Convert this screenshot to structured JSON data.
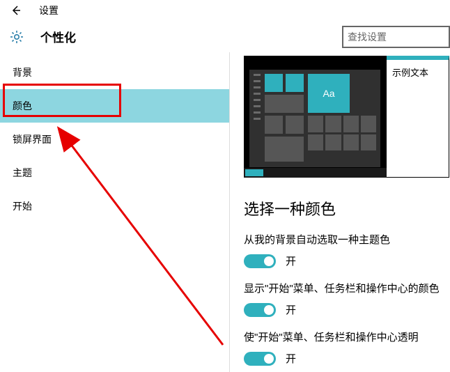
{
  "topbar": {
    "title": "设置"
  },
  "header": {
    "section": "个性化"
  },
  "search": {
    "placeholder": "查找设置"
  },
  "sidebar": {
    "items": [
      {
        "label": "背景"
      },
      {
        "label": "颜色"
      },
      {
        "label": "锁屏界面"
      },
      {
        "label": "主题"
      },
      {
        "label": "开始"
      }
    ],
    "selected_index": 1
  },
  "preview": {
    "aa_text": "Aa",
    "sample_text": "示例文本"
  },
  "content": {
    "heading": "选择一种颜色",
    "settings": [
      {
        "label": "从我的背景自动选取一种主题色",
        "state": "开"
      },
      {
        "label": "显示\"开始\"菜单、任务栏和操作中心的颜色",
        "state": "开"
      },
      {
        "label": "使\"开始\"菜单、任务栏和操作中心透明",
        "state": "开"
      }
    ]
  }
}
